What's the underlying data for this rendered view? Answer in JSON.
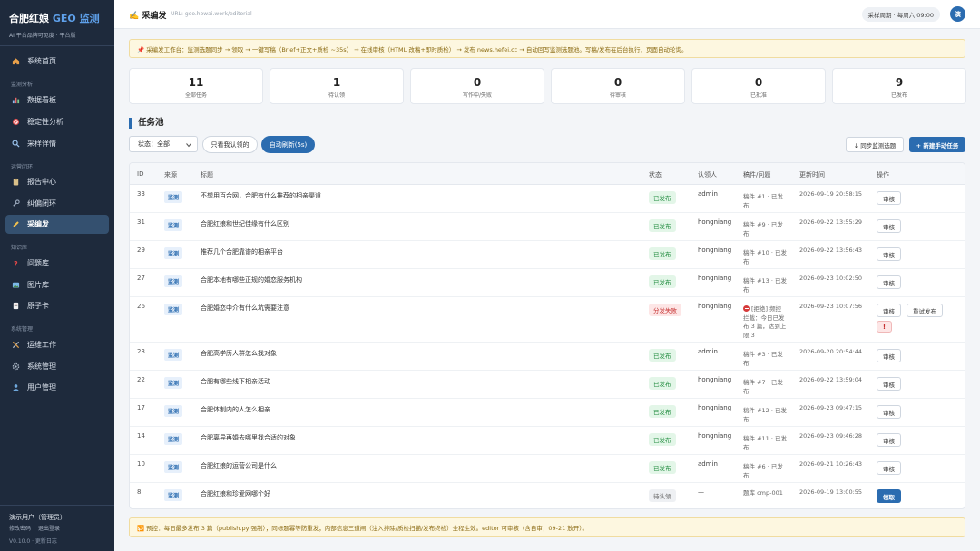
{
  "sidebar": {
    "brand_main": "合肥红娘",
    "brand_geo": "GEO 监测",
    "brand_sub": "AI 平台品牌可见度 · 平台版",
    "home": "系统首页",
    "sections": [
      "监测分析",
      "运营闭环",
      "知识库",
      "系统管理"
    ],
    "items": [
      {
        "label": "数据看板",
        "icon": "chart-icon"
      },
      {
        "label": "稳定性分析",
        "icon": "target-icon"
      },
      {
        "label": "采样详情",
        "icon": "search-icon"
      },
      {
        "label": "报告中心",
        "icon": "clipboard-icon"
      },
      {
        "label": "纠偏闭环",
        "icon": "wrench-icon"
      },
      {
        "label": "采编发",
        "icon": "pen-icon"
      },
      {
        "label": "问题库",
        "icon": "question-icon"
      },
      {
        "label": "图片库",
        "icon": "image-icon"
      },
      {
        "label": "原子卡",
        "icon": "card-icon"
      },
      {
        "label": "运维工作",
        "icon": "tools-icon"
      },
      {
        "label": "系统管理",
        "icon": "gear-icon"
      },
      {
        "label": "用户管理",
        "icon": "user-icon"
      }
    ],
    "user_name": "演示用户（管理员）",
    "change_password": "修改密码",
    "logout": "退出登录",
    "version": "V0.10.0 · 更新日志"
  },
  "topbar": {
    "title": "✍️ 采编发",
    "url": "URL: geo.howai.work/editorial",
    "schedule": "采样周期 · 每周六 09:00",
    "avatar": "演"
  },
  "notice_top": "📌 采编发工作台：监测选题同步 → 领取 → 一键写稿（Brief+正文+质检 ~35s） → 在线审核（HTML 改稿+即时质检） → 发布 news.hefei.cc → 自动回写监测选题池。写稿/发布在后台执行，页面自动轮询。",
  "notice_bottom": "🔁 预控：每日最多发布 3 篇（publish.py 强制）；同标题幂等防重发；内部信息三道闸（注入排除/质检扫描/发布终检）全程生效。editor 可审核（含自审，09-21 放开）。",
  "stats": [
    {
      "value": "11",
      "label": "全部任务"
    },
    {
      "value": "1",
      "label": "待认领"
    },
    {
      "value": "0",
      "label": "写作中/失败"
    },
    {
      "value": "0",
      "label": "待审核"
    },
    {
      "value": "0",
      "label": "已批准"
    },
    {
      "value": "9",
      "label": "已发布"
    }
  ],
  "section_title": "任务池",
  "filters": {
    "status_select": "状态：全部",
    "only_mine": "只看我认领的",
    "auto_refresh": "自动刷新(5s)",
    "sync": "↓ 同步监测选题",
    "new_task": "+ 新建手动任务"
  },
  "table": {
    "headers": [
      "ID",
      "来源",
      "标题",
      "状态",
      "认领人",
      "稿件/问题",
      "更新时间",
      "操作"
    ],
    "rows": [
      {
        "id": "33",
        "source": "监测",
        "title": "不想用百合网，合肥有什么推荐的相亲渠道",
        "status": "已发布",
        "status_type": "done",
        "user": "admin",
        "draft": "稿件 #1 · 已发布",
        "time": "2026-09-19 20:58:15",
        "op": "审核"
      },
      {
        "id": "31",
        "source": "监测",
        "title": "合肥红娘和世纪佳缘有什么区别",
        "status": "已发布",
        "status_type": "done",
        "user": "hongniang",
        "draft": "稿件 #9 · 已发布",
        "time": "2026-09-22 13:55:29",
        "op": "审核"
      },
      {
        "id": "29",
        "source": "监测",
        "title": "推荐几个合肥靠谱的相亲平台",
        "status": "已发布",
        "status_type": "done",
        "user": "hongniang",
        "draft": "稿件 #10 · 已发布",
        "time": "2026-09-22 13:56:43",
        "op": "审核"
      },
      {
        "id": "27",
        "source": "监测",
        "title": "合肥本地有哪些正规的婚恋服务机构",
        "status": "已发布",
        "status_type": "done",
        "user": "hongniang",
        "draft": "稿件 #13 · 已发布",
        "time": "2026-09-23 10:02:50",
        "op": "审核"
      },
      {
        "id": "26",
        "source": "监测",
        "title": "合肥婚恋中介有什么坑需要注意",
        "status": "分发失败",
        "status_type": "fail",
        "user": "hongniang",
        "draft": "[拒绝] 频控拦截：今日已发布 3 篇，达到上限 3",
        "time": "2026-09-23 10:07:56",
        "op": "审核",
        "retry": "重试发布",
        "warn": "!"
      },
      {
        "id": "23",
        "source": "监测",
        "title": "合肥高学历人群怎么找对象",
        "status": "已发布",
        "status_type": "done",
        "user": "admin",
        "draft": "稿件 #3 · 已发布",
        "time": "2026-09-20 20:54:44",
        "op": "审核"
      },
      {
        "id": "22",
        "source": "监测",
        "title": "合肥有哪些线下相亲活动",
        "status": "已发布",
        "status_type": "done",
        "user": "hongniang",
        "draft": "稿件 #7 · 已发布",
        "time": "2026-09-22 13:59:04",
        "op": "审核"
      },
      {
        "id": "17",
        "source": "监测",
        "title": "合肥体制内的人怎么相亲",
        "status": "已发布",
        "status_type": "done",
        "user": "hongniang",
        "draft": "稿件 #12 · 已发布",
        "time": "2026-09-23 09:47:15",
        "op": "审核"
      },
      {
        "id": "14",
        "source": "监测",
        "title": "合肥离异再婚去哪里找合适的对象",
        "status": "已发布",
        "status_type": "done",
        "user": "hongniang",
        "draft": "稿件 #11 · 已发布",
        "time": "2026-09-23 09:46:28",
        "op": "审核"
      },
      {
        "id": "10",
        "source": "监测",
        "title": "合肥红娘的运营公司是什么",
        "status": "已发布",
        "status_type": "done",
        "user": "admin",
        "draft": "稿件 #6 · 已发布",
        "time": "2026-09-21 10:26:43",
        "op": "审核"
      },
      {
        "id": "8",
        "source": "监测",
        "title": "合肥红娘和珍爱网哪个好",
        "status": "待认领",
        "status_type": "wait",
        "user": "—",
        "draft": "题库 cmp-001",
        "time": "2026-09-19 13:00:55",
        "op": "领取"
      }
    ]
  }
}
